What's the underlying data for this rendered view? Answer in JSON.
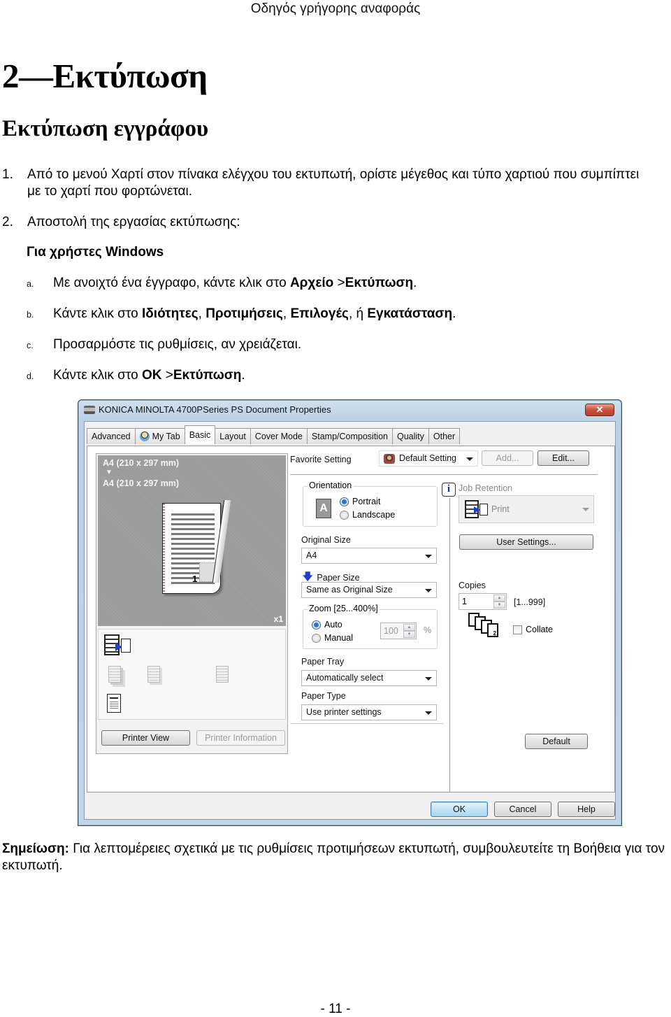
{
  "running_header": "Οδηγός γρήγορης αναφοράς",
  "chapter_title": "2—Εκτύπωση",
  "section_title": "Εκτύπωση εγγράφου",
  "steps": [
    {
      "num": "1.",
      "text": "Από το μενού Χαρτί στον πίνακα ελέγχου του εκτυπωτή, ορίστε μέγεθος και τύπο χαρτιού που συμπίπτει με το χαρτί που φορτώνεται."
    },
    {
      "num": "2.",
      "text": "Αποστολή της εργασίας εκτύπωσης:"
    }
  ],
  "windows_heading": "Για χρήστες Windows",
  "substeps": [
    {
      "label": "a.",
      "parts": [
        "Με ανοιχτό ένα έγγραφο, κάντε κλικ στο ",
        "Αρχείο",
        " >",
        "Εκτύπωση",
        "."
      ]
    },
    {
      "label": "b.",
      "parts": [
        "Κάντε κλικ στο ",
        "Ιδιότητες",
        ", ",
        "Προτιμήσεις",
        ", ",
        "Επιλογές",
        ", ή ",
        "Εγκατάσταση",
        "."
      ]
    },
    {
      "label": "c.",
      "parts": [
        "Προσαρμόστε τις ρυθμίσεις, αν χρειάζεται."
      ]
    },
    {
      "label": "d.",
      "parts": [
        "Κάντε κλικ στο ",
        "OK",
        " >",
        "Εκτύπωση",
        "."
      ]
    }
  ],
  "dialog": {
    "title": "KONICA MINOLTA 4700PSeries PS Document Properties",
    "close_label": "✕",
    "tabs": [
      "Advanced",
      "My Tab",
      "Basic",
      "Layout",
      "Cover Mode",
      "Stamp/Composition",
      "Quality",
      "Other"
    ],
    "active_tab": "Basic",
    "preview": {
      "original": "A4 (210 x 297 mm)",
      "arrow": "▼",
      "output": "A4 (210 x 297 mm)",
      "page_number": "1",
      "copies_badge": "x1"
    },
    "printer_view_label": "Printer View",
    "printer_info_label": "Printer Information",
    "favorite_setting_label": "Favorite Setting",
    "favorite_setting_value": "Default Setting",
    "add_label": "Add...",
    "edit_label": "Edit...",
    "orientation": {
      "label": "Orientation",
      "glyph": "A",
      "options": [
        "Portrait",
        "Landscape"
      ],
      "selected": "Portrait"
    },
    "original_size": {
      "label": "Original Size",
      "value": "A4"
    },
    "paper_size": {
      "label": "Paper Size",
      "value": "Same as Original Size"
    },
    "zoom": {
      "label": "Zoom [25...400%]",
      "options": [
        "Auto",
        "Manual"
      ],
      "selected": "Auto",
      "value": "100",
      "unit": "%"
    },
    "paper_tray": {
      "label": "Paper Tray",
      "value": "Automatically select"
    },
    "paper_type": {
      "label": "Paper Type",
      "value": "Use printer settings"
    },
    "job_retention": {
      "label": "Job Retention",
      "value": "Print",
      "info_glyph": "i"
    },
    "user_settings_label": "User Settings...",
    "copies": {
      "label": "Copies",
      "value": "1",
      "range": "[1...999]"
    },
    "collate_label": "Collate",
    "collate_checked": false,
    "default_label": "Default",
    "ok_label": "OK",
    "cancel_label": "Cancel",
    "help_label": "Help"
  },
  "note": {
    "label": "Σημείωση:",
    "text": " Για λεπτομέρειες σχετικά με τις ρυθμίσεις προτιμήσεων εκτυπωτή, συμβουλευτείτε τη Βοήθεια για τον εκτυπωτή."
  },
  "page_number": "- 11 -"
}
